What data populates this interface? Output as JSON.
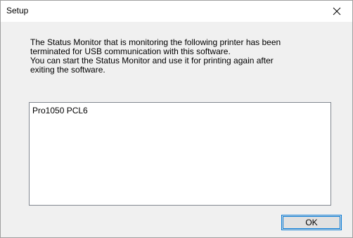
{
  "window": {
    "title": "Setup"
  },
  "message": {
    "line1": "The Status Monitor that is monitoring the following printer has been",
    "line2": "terminated for USB communication with this software.",
    "line3": "You can start the Status Monitor and use it for printing again after",
    "line4": "exiting the software."
  },
  "printer_list": {
    "items": [
      "Pro1050 PCL6"
    ]
  },
  "buttons": {
    "ok_label": "OK"
  },
  "icons": {
    "close": "close-icon"
  },
  "colors": {
    "focus_border": "#0078d7",
    "dialog_bg": "#f0f0f0"
  }
}
